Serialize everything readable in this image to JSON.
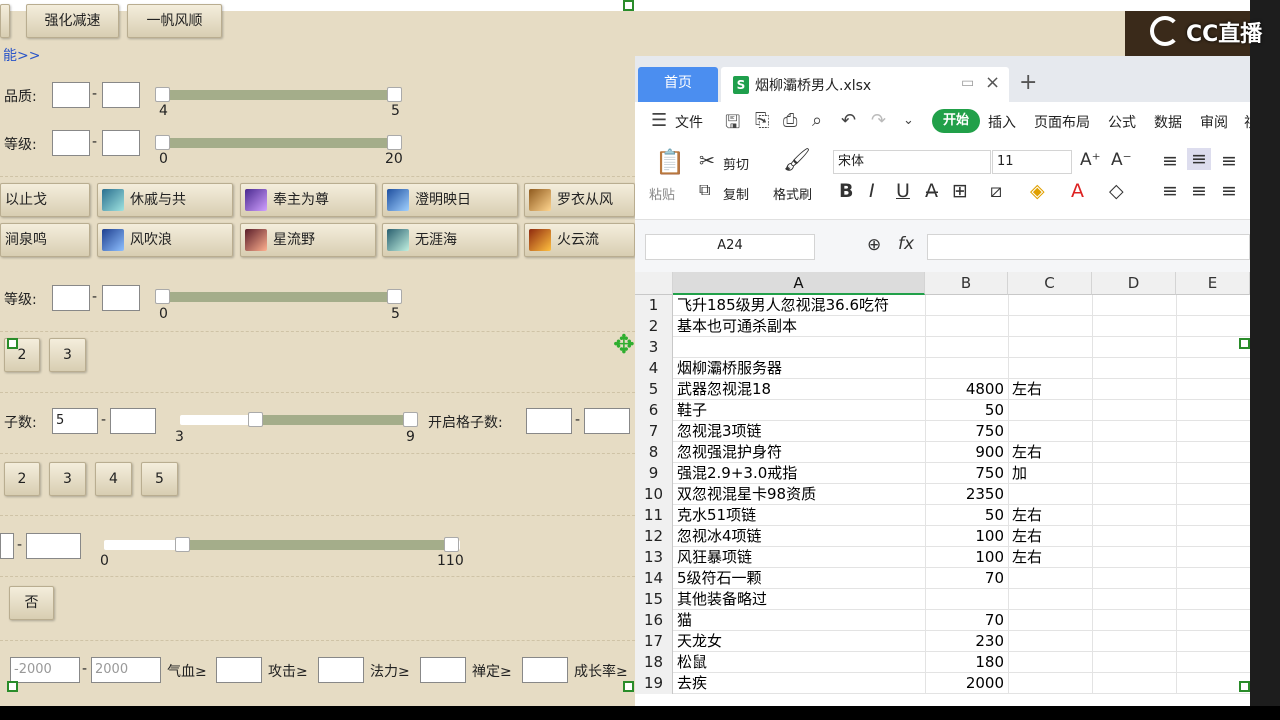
{
  "game": {
    "top_buttons": [
      "强化减速",
      "一帆风顺"
    ],
    "link_more": "能>>",
    "quality": {
      "label": "品质:",
      "min_tick": "4",
      "max_tick": "5"
    },
    "level1": {
      "label": "等级:",
      "min_tick": "0",
      "max_tick": "20"
    },
    "skills_row1": [
      "以止戈",
      "休戚与共",
      "奉主为尊",
      "澄明映日",
      "罗衣从风"
    ],
    "skills_row2": [
      "涧泉鸣",
      "风吹浪",
      "星流野",
      "无涯海",
      "火云流"
    ],
    "level2": {
      "label": "等级:",
      "min_tick": "0",
      "max_tick": "5"
    },
    "num_buttons_a": [
      "2",
      "3"
    ],
    "slots": {
      "label": "子数:",
      "value": "5",
      "min_tick": "3",
      "max_tick": "9",
      "open_label": "开启格子数:"
    },
    "num_buttons_b": [
      "2",
      "3",
      "4",
      "5"
    ],
    "price": {
      "min_tick": "0",
      "max_tick": "110"
    },
    "no_button": "否",
    "bottom": {
      "min_placeholder": "-2000",
      "max_placeholder": "2000",
      "hp_label": "气血≥",
      "atk_label": "攻击≥",
      "mp_label": "法力≥",
      "zen_label": "禅定≥",
      "growth_label": "成长率≥"
    }
  },
  "logo": {
    "text": "CC直播"
  },
  "spreadsheet": {
    "tab_home": "首页",
    "file_name": "烟柳灞桥男人.xlsx",
    "menu": {
      "file": "文件",
      "start": "开始",
      "insert": "插入",
      "page_layout": "页面布局",
      "formula": "公式",
      "data": "数据",
      "review": "审阅",
      "view": "视"
    },
    "toolbar": {
      "paste": "粘贴",
      "cut": "剪切",
      "copy": "复制",
      "format_painter": "格式刷",
      "font": "宋体",
      "font_size": "11"
    },
    "name_box": "A24",
    "fx": "fx",
    "columns": [
      "A",
      "B",
      "C",
      "D",
      "E"
    ],
    "rows": [
      {
        "n": "1",
        "a": "飞升185级男人忽视混36.6吃符",
        "b": "",
        "c": ""
      },
      {
        "n": "2",
        "a": "基本也可通杀副本",
        "b": "",
        "c": ""
      },
      {
        "n": "3",
        "a": "",
        "b": "",
        "c": ""
      },
      {
        "n": "4",
        "a": "烟柳灞桥服务器",
        "b": "",
        "c": ""
      },
      {
        "n": "5",
        "a": "武器忽视混18",
        "b": "4800",
        "c": "左右"
      },
      {
        "n": "6",
        "a": "鞋子",
        "b": "50",
        "c": ""
      },
      {
        "n": "7",
        "a": "忽视混3项链",
        "b": "750",
        "c": ""
      },
      {
        "n": "8",
        "a": "忽视强混护身符",
        "b": "900",
        "c": "左右"
      },
      {
        "n": "9",
        "a": "强混2.9+3.0戒指",
        "b": "750",
        "c": "加"
      },
      {
        "n": "10",
        "a": "双忽视混星卡98资质",
        "b": "2350",
        "c": ""
      },
      {
        "n": "11",
        "a": "克水51项链",
        "b": "50",
        "c": "左右"
      },
      {
        "n": "12",
        "a": "忽视冰4项链",
        "b": "100",
        "c": "左右"
      },
      {
        "n": "13",
        "a": "风狂暴项链",
        "b": "100",
        "c": "左右"
      },
      {
        "n": "14",
        "a": "5级符石一颗",
        "b": "70",
        "c": ""
      },
      {
        "n": "15",
        "a": "其他装备略过",
        "b": "",
        "c": ""
      },
      {
        "n": "16",
        "a": "猫",
        "b": "70",
        "c": ""
      },
      {
        "n": "17",
        "a": "天龙女",
        "b": "230",
        "c": ""
      },
      {
        "n": "18",
        "a": "松鼠",
        "b": "180",
        "c": ""
      },
      {
        "n": "19",
        "a": "去疾",
        "b": "2000",
        "c": ""
      }
    ]
  }
}
